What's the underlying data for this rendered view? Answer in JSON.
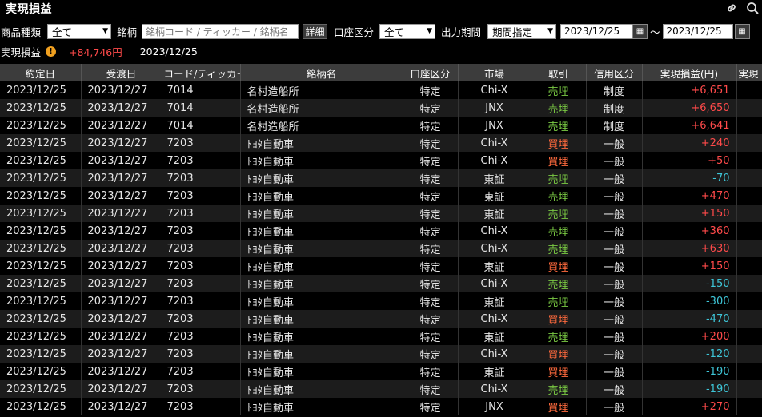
{
  "title": "実現損益",
  "icons": {
    "link": "link-icon",
    "search": "search-icon"
  },
  "filters": {
    "product_label": "商品種類",
    "product_value": "全て",
    "symbol_label": "銘柄",
    "symbol_placeholder": "銘柄コード / ティッカー / 銘柄名",
    "detail_button": "詳細",
    "account_label": "口座区分",
    "account_value": "全て",
    "period_label": "出力期間",
    "period_value": "期間指定",
    "date_from": "2023/12/25",
    "date_separator": "～",
    "date_to": "2023/12/25"
  },
  "summary": {
    "label": "実現損益",
    "value": "+84,746円",
    "date": "2023/12/25"
  },
  "columns": [
    "約定日",
    "受渡日",
    "コード/ティッカー",
    "銘柄名",
    "口座区分",
    "市場",
    "取引",
    "信用区分",
    "実現損益(円)",
    "実現"
  ],
  "rows": [
    [
      "2023/12/25",
      "2023/12/27",
      "7014",
      "名村造船所",
      "特定",
      "Chi-X",
      "売埋",
      "制度",
      "+6,651"
    ],
    [
      "2023/12/25",
      "2023/12/27",
      "7014",
      "名村造船所",
      "特定",
      "JNX",
      "売埋",
      "制度",
      "+6,650"
    ],
    [
      "2023/12/25",
      "2023/12/27",
      "7014",
      "名村造船所",
      "特定",
      "JNX",
      "売埋",
      "制度",
      "+6,641"
    ],
    [
      "2023/12/25",
      "2023/12/27",
      "7203",
      "ﾄﾖﾀ自動車",
      "特定",
      "Chi-X",
      "買埋",
      "一般",
      "+240"
    ],
    [
      "2023/12/25",
      "2023/12/27",
      "7203",
      "ﾄﾖﾀ自動車",
      "特定",
      "Chi-X",
      "買埋",
      "一般",
      "+50"
    ],
    [
      "2023/12/25",
      "2023/12/27",
      "7203",
      "ﾄﾖﾀ自動車",
      "特定",
      "東証",
      "売埋",
      "一般",
      "-70"
    ],
    [
      "2023/12/25",
      "2023/12/27",
      "7203",
      "ﾄﾖﾀ自動車",
      "特定",
      "東証",
      "売埋",
      "一般",
      "+470"
    ],
    [
      "2023/12/25",
      "2023/12/27",
      "7203",
      "ﾄﾖﾀ自動車",
      "特定",
      "東証",
      "売埋",
      "一般",
      "+150"
    ],
    [
      "2023/12/25",
      "2023/12/27",
      "7203",
      "ﾄﾖﾀ自動車",
      "特定",
      "Chi-X",
      "売埋",
      "一般",
      "+360"
    ],
    [
      "2023/12/25",
      "2023/12/27",
      "7203",
      "ﾄﾖﾀ自動車",
      "特定",
      "Chi-X",
      "売埋",
      "一般",
      "+630"
    ],
    [
      "2023/12/25",
      "2023/12/27",
      "7203",
      "ﾄﾖﾀ自動車",
      "特定",
      "東証",
      "買埋",
      "一般",
      "+150"
    ],
    [
      "2023/12/25",
      "2023/12/27",
      "7203",
      "ﾄﾖﾀ自動車",
      "特定",
      "Chi-X",
      "売埋",
      "一般",
      "-150"
    ],
    [
      "2023/12/25",
      "2023/12/27",
      "7203",
      "ﾄﾖﾀ自動車",
      "特定",
      "東証",
      "売埋",
      "一般",
      "-300"
    ],
    [
      "2023/12/25",
      "2023/12/27",
      "7203",
      "ﾄﾖﾀ自動車",
      "特定",
      "Chi-X",
      "買埋",
      "一般",
      "-470"
    ],
    [
      "2023/12/25",
      "2023/12/27",
      "7203",
      "ﾄﾖﾀ自動車",
      "特定",
      "東証",
      "売埋",
      "一般",
      "+200"
    ],
    [
      "2023/12/25",
      "2023/12/27",
      "7203",
      "ﾄﾖﾀ自動車",
      "特定",
      "Chi-X",
      "買埋",
      "一般",
      "-120"
    ],
    [
      "2023/12/25",
      "2023/12/27",
      "7203",
      "ﾄﾖﾀ自動車",
      "特定",
      "東証",
      "買埋",
      "一般",
      "-190"
    ],
    [
      "2023/12/25",
      "2023/12/27",
      "7203",
      "ﾄﾖﾀ自動車",
      "特定",
      "Chi-X",
      "売埋",
      "一般",
      "-190"
    ],
    [
      "2023/12/25",
      "2023/12/27",
      "7203",
      "ﾄﾖﾀ自動車",
      "特定",
      "JNX",
      "買埋",
      "一般",
      "+270"
    ]
  ],
  "colors": {
    "sell": "#7ac943",
    "buy": "#ff6a3d",
    "positive": "#ff4a4a",
    "negative": "#3ec6d8"
  }
}
